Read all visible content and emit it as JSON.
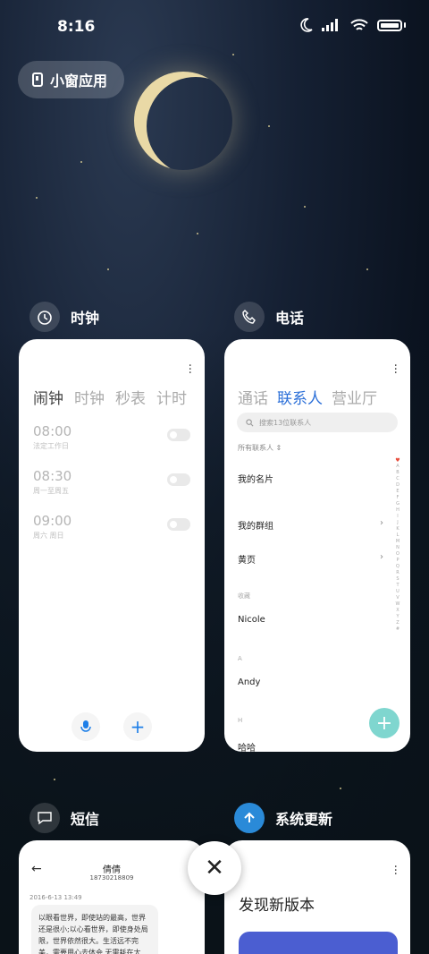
{
  "status_bar": {
    "time": "8:16"
  },
  "floating_windows": {
    "label": "小窗应用"
  },
  "apps": [
    {
      "name": "时钟",
      "tabs": [
        "闹钟",
        "时钟",
        "秒表",
        "计时"
      ],
      "alarms": [
        {
          "time": "08:00",
          "repeat": "法定工作日"
        },
        {
          "time": "08:30",
          "repeat": "周一至周五"
        },
        {
          "time": "09:00",
          "repeat": "周六 周日"
        }
      ]
    },
    {
      "name": "电话",
      "tabs": [
        "通话",
        "联系人",
        "营业厅"
      ],
      "search_placeholder": "搜索13位联系人",
      "all_contacts": "所有联系人",
      "rows": [
        "我的名片",
        "我的群组",
        "黄页"
      ],
      "favorites_label": "收藏",
      "favorites": [
        "Nicole"
      ],
      "section_a": "A",
      "section_a_items": [
        "Andy"
      ],
      "section_h": "H",
      "section_h_items": [
        "哈哈"
      ],
      "index_letters": [
        "A",
        "B",
        "C",
        "D",
        "E",
        "F",
        "G",
        "H",
        "I",
        "J",
        "K",
        "L",
        "M",
        "N",
        "O",
        "P",
        "Q",
        "R",
        "S",
        "T",
        "U",
        "V",
        "W",
        "X",
        "Y",
        "Z",
        "#"
      ]
    },
    {
      "name": "短信",
      "contact": "倩倩",
      "phone": "18730218809",
      "date": "2016-6-13 13:49",
      "message": "以眼看世界，即使站的最高，世界还是很小;以心看世界，即使身处局限，世界依然很大。生活远不完美，需要用心去体会,无需耗在太"
    },
    {
      "name": "系统更新",
      "headline": "发现新版本"
    }
  ],
  "accent_colors": {
    "clock_fab": "#1e7fe8",
    "contacts_tab": "#2b6fd8",
    "contacts_fab": "#7fd6cf",
    "update_banner": "#4b5ed1"
  }
}
